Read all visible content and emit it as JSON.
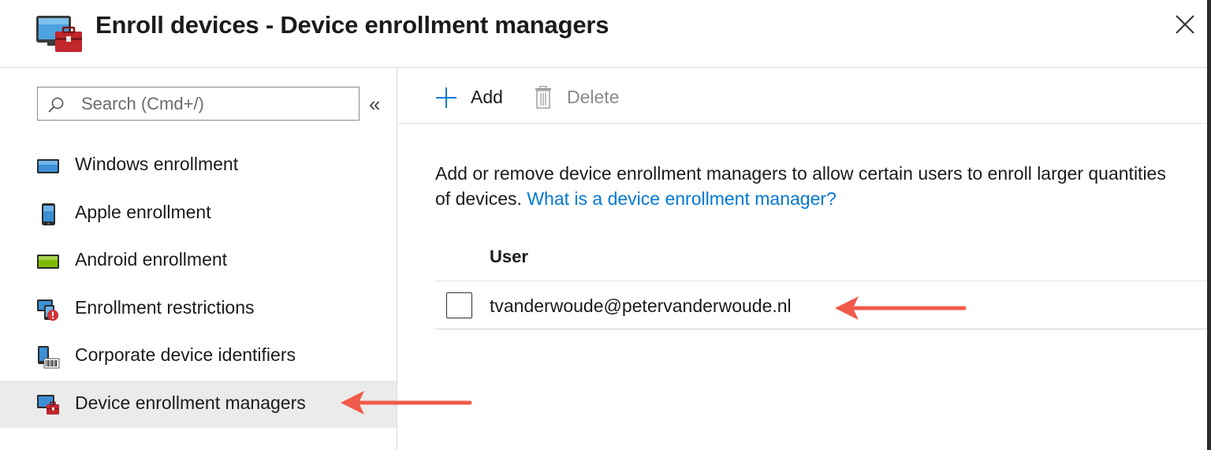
{
  "header": {
    "title": "Enroll devices - Device enrollment managers",
    "icon": "device-enrollment-managers-icon",
    "close_icon": "close-icon"
  },
  "sidebar": {
    "search": {
      "placeholder": "Search (Cmd+/)",
      "value": ""
    },
    "collapse_label": "«",
    "items": [
      {
        "label": "Windows enrollment",
        "icon": "windows-device-icon",
        "active": false
      },
      {
        "label": "Apple enrollment",
        "icon": "apple-device-icon",
        "active": false
      },
      {
        "label": "Android enrollment",
        "icon": "android-device-icon",
        "active": false
      },
      {
        "label": "Enrollment restrictions",
        "icon": "enrollment-restrictions-icon",
        "active": false
      },
      {
        "label": "Corporate device identifiers",
        "icon": "corporate-device-identifiers-icon",
        "active": false
      },
      {
        "label": "Device enrollment managers",
        "icon": "device-enrollment-managers-icon",
        "active": true
      }
    ]
  },
  "toolbar": {
    "add_label": "Add",
    "delete_label": "Delete"
  },
  "main": {
    "description": "Add or remove device enrollment managers to allow certain users to enroll larger quantities of devices.",
    "help_link": "What is a device enrollment manager?",
    "table": {
      "column_header": "User",
      "rows": [
        {
          "user": "tvanderwoude@petervanderwoude.nl",
          "checked": false
        }
      ]
    }
  },
  "colors": {
    "accent": "#0078d4",
    "annotation_arrow": "#f05a4a",
    "active_item_bg": "#ebebeb"
  }
}
